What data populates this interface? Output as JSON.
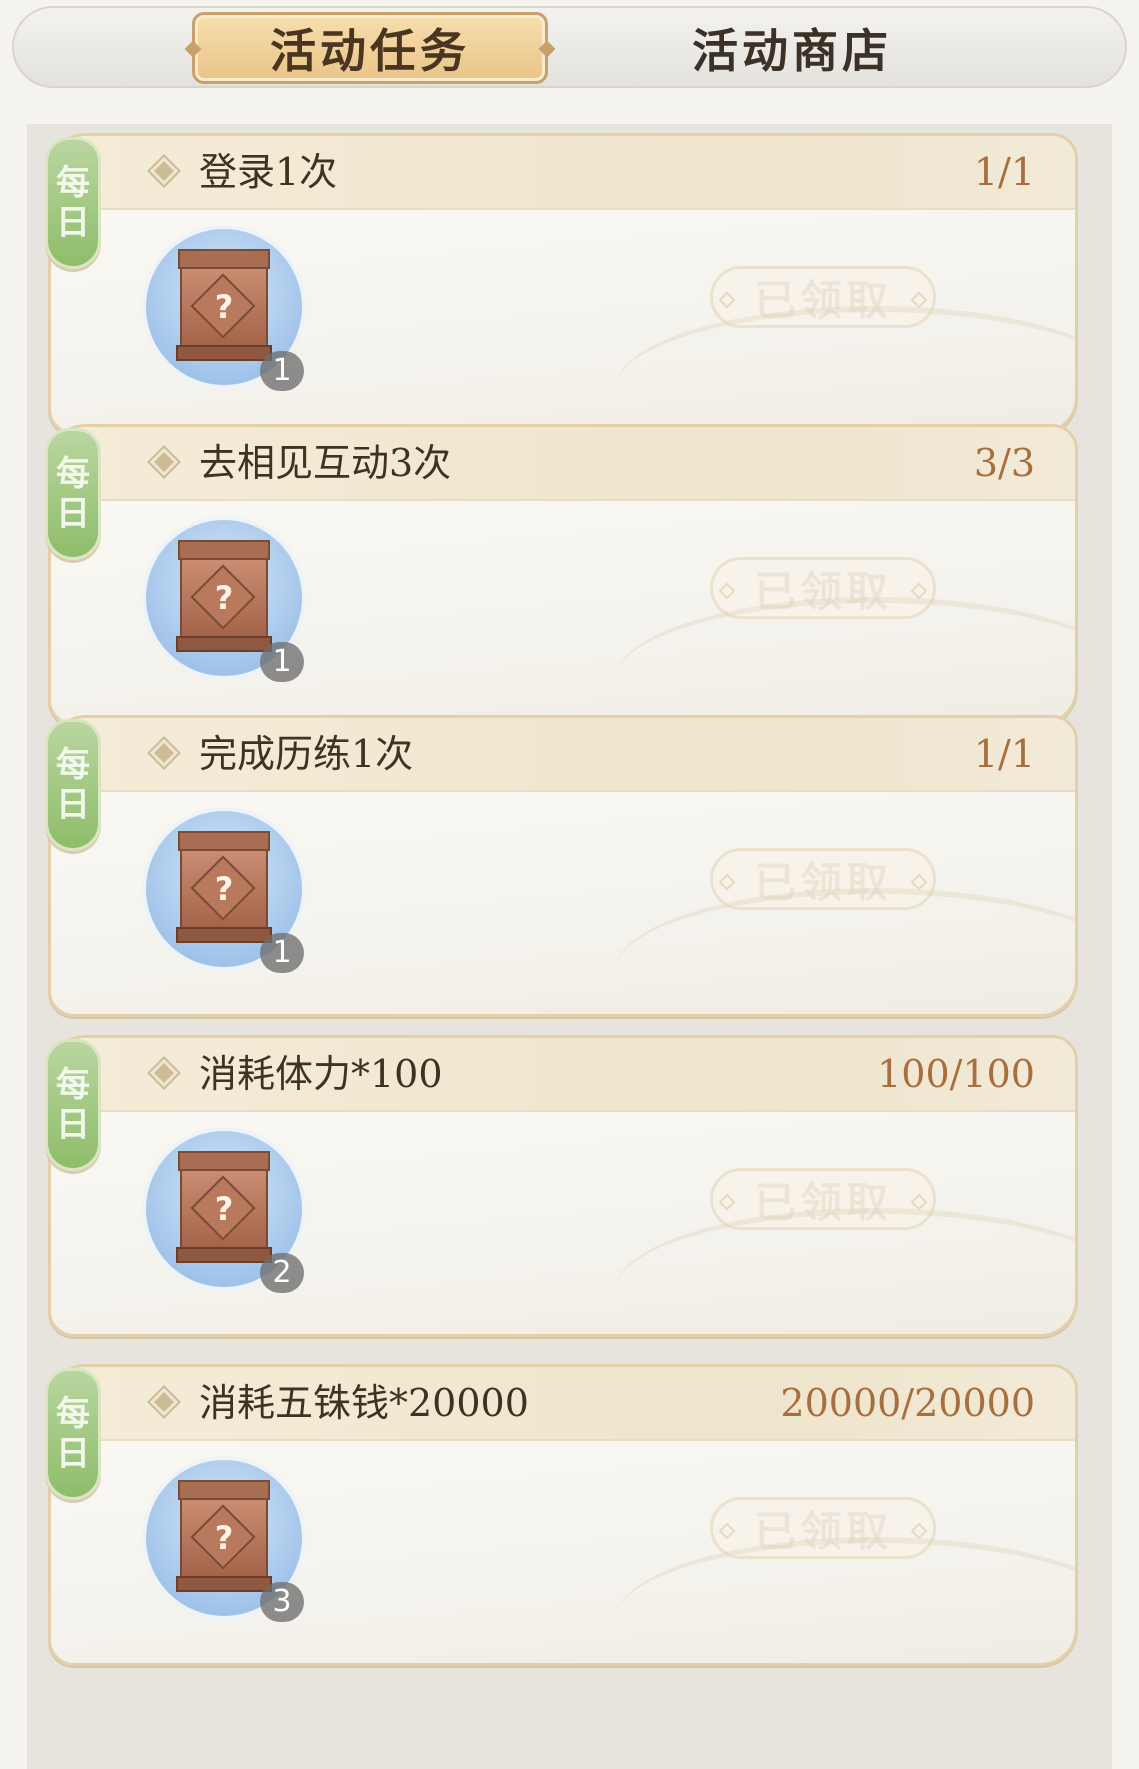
{
  "tabs": [
    {
      "label": "活动任务",
      "active": true
    },
    {
      "label": "活动商店",
      "active": false
    }
  ],
  "daily_badge": [
    "每",
    "日"
  ],
  "tasks": [
    {
      "title": "登录1次",
      "progress": "1/1",
      "reward_count": "1",
      "button": "已领取"
    },
    {
      "title": "去相见互动3次",
      "progress": "3/3",
      "reward_count": "1",
      "button": "已领取"
    },
    {
      "title": "完成历练1次",
      "progress": "1/1",
      "reward_count": "1",
      "button": "已领取"
    },
    {
      "title": "消耗体力*100",
      "progress": "100/100",
      "reward_count": "2",
      "button": "已领取"
    },
    {
      "title": "消耗五铢钱*20000",
      "progress": "20000/20000",
      "reward_count": "3",
      "button": "已领取"
    }
  ],
  "colors": {
    "accent_tab": "#e9c488",
    "daily_green": "#8fbd6a",
    "progress_text": "#a76f3d"
  }
}
